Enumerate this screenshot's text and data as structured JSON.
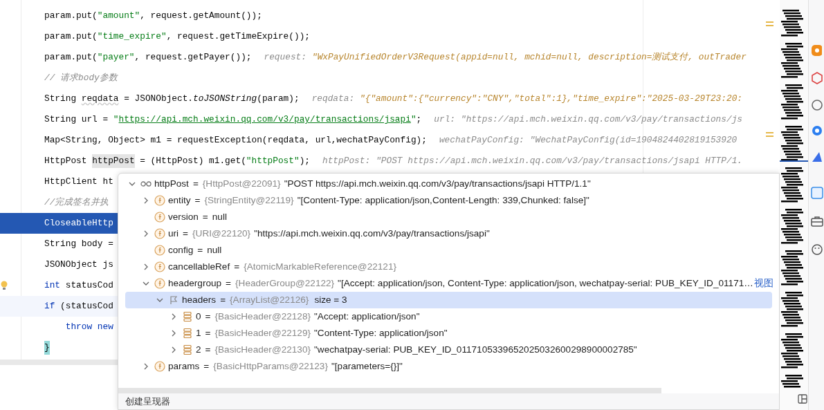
{
  "editor": {
    "lines": [
      {
        "kind": "normal",
        "bulb": false,
        "tokens": [
          {
            "kind": "plain",
            "text": "param.put("
          },
          {
            "kind": "string",
            "text": "\"amount\""
          },
          {
            "kind": "plain",
            "text": ", request.getAmount());"
          }
        ]
      },
      {
        "kind": "normal",
        "bulb": false,
        "tokens": [
          {
            "kind": "plain",
            "text": "param.put("
          },
          {
            "kind": "string",
            "text": "\"time_expire\""
          },
          {
            "kind": "plain",
            "text": ", request.getTimeExpire());"
          }
        ]
      },
      {
        "kind": "normal",
        "bulb": false,
        "tokens": [
          {
            "kind": "plain",
            "text": "param.put("
          },
          {
            "kind": "string",
            "text": "\"payer\""
          },
          {
            "kind": "plain",
            "text": ", request.getPayer());"
          }
        ],
        "hint": {
          "label": "request:",
          "value": "\"WxPayUnifiedOrderV3Request(appid=null, mchid=null, description=测试支付, outTrader",
          "changed": true
        }
      },
      {
        "kind": "normal",
        "bulb": false,
        "tokens": [
          {
            "kind": "comment",
            "text": "// 请求body参数"
          }
        ]
      },
      {
        "kind": "normal",
        "bulb": false,
        "tokens": [
          {
            "kind": "plain",
            "text": "String "
          },
          {
            "kind": "squiggle",
            "text": "reqdata"
          },
          {
            "kind": "plain",
            "text": " = JSONObject."
          },
          {
            "kind": "italic",
            "text": "toJSONString"
          },
          {
            "kind": "plain",
            "text": "(param);"
          }
        ],
        "hint": {
          "label": "reqdata:",
          "value": "\"{\"amount\":{\"currency\":\"CNY\",\"total\":1},\"time_expire\":\"2025-03-29T23:20:",
          "changed": true
        }
      },
      {
        "kind": "normal",
        "bulb": false,
        "tokens": [
          {
            "kind": "plain",
            "text": "String url = "
          },
          {
            "kind": "string",
            "text": "\""
          },
          {
            "kind": "link",
            "text": "https://api.mch.weixin.qq.com/v3/pay/transactions/jsapi"
          },
          {
            "kind": "string",
            "text": "\""
          },
          {
            "kind": "plain",
            "text": ";"
          }
        ],
        "hint": {
          "label": "url:",
          "value": "\"https://api.mch.weixin.qq.com/v3/pay/transactions/js",
          "changed": false
        }
      },
      {
        "kind": "normal",
        "bulb": false,
        "tokens": [
          {
            "kind": "plain",
            "text": "Map<String, Object> m1 = requestException(reqdata, url,wechatPayConfig);"
          }
        ],
        "hint": {
          "label": "wechatPayConfig:",
          "value": "\"WechatPayConfig(id=1904824402819153920",
          "changed": false
        }
      },
      {
        "kind": "normal",
        "bulb": false,
        "tokens": [
          {
            "kind": "plain",
            "text": "HttpPost "
          },
          {
            "kind": "mark",
            "text": "httpPost"
          },
          {
            "kind": "plain",
            "text": " = (HttpPost) m1.get("
          },
          {
            "kind": "string",
            "text": "\"httpPost\""
          },
          {
            "kind": "plain",
            "text": ");"
          }
        ],
        "hint": {
          "label": "httpPost:",
          "value": "\"POST https://api.mch.weixin.qq.com/v3/pay/transactions/jsapi HTTP/1.",
          "changed": false
        }
      },
      {
        "kind": "normal",
        "bulb": false,
        "tokens": [
          {
            "kind": "plain",
            "text": "HttpClient ht"
          }
        ]
      },
      {
        "kind": "normal",
        "bulb": false,
        "tokens": [
          {
            "kind": "comment",
            "text": "//完成签名并执"
          }
        ]
      },
      {
        "kind": "current",
        "bulb": false,
        "tokens": [
          {
            "kind": "plain",
            "text": "CloseableHttp"
          }
        ]
      },
      {
        "kind": "normal",
        "bulb": false,
        "tokens": [
          {
            "kind": "plain",
            "text": "String body ="
          }
        ]
      },
      {
        "kind": "normal",
        "bulb": false,
        "tokens": [
          {
            "kind": "plain",
            "text": "JSONObject js"
          }
        ]
      },
      {
        "kind": "normal",
        "bulb": true,
        "tokens": [
          {
            "kind": "keyword",
            "text": "int"
          },
          {
            "kind": "plain",
            "text": " statusCod"
          }
        ]
      },
      {
        "kind": "caret",
        "bulb": false,
        "tokens": [
          {
            "kind": "keyword",
            "text": "if"
          },
          {
            "kind": "plain",
            "text": " (statusCod"
          }
        ]
      },
      {
        "kind": "normal",
        "bulb": false,
        "tokens": [
          {
            "kind": "keyword",
            "text": "    throw new"
          }
        ]
      },
      {
        "kind": "normal",
        "bulb": false,
        "tokens": [
          {
            "kind": "match",
            "text": "}"
          }
        ]
      }
    ]
  },
  "debug_popup": {
    "tree": [
      {
        "kind": "watch",
        "name": "httpPost",
        "operator": "=",
        "ref": "{HttpPost@22091}",
        "value": "\"POST https://api.mch.weixin.qq.com/v3/pay/transactions/jsapi HTTP/1.1\"",
        "expanded": true,
        "selected": false,
        "children": [
          {
            "kind": "field",
            "name": "entity",
            "operator": "=",
            "ref": "{StringEntity@22119}",
            "value": "\"[Content-Type: application/json,Content-Length: 339,Chunked: false]\"",
            "expanded": false,
            "selected": false
          },
          {
            "kind": "field",
            "name": "version",
            "operator": "=",
            "value": "null",
            "selected": false
          },
          {
            "kind": "field",
            "name": "uri",
            "operator": "=",
            "ref": "{URI@22120}",
            "value": "\"https://api.mch.weixin.qq.com/v3/pay/transactions/jsapi\"",
            "expanded": false,
            "selected": false
          },
          {
            "kind": "field",
            "name": "config",
            "operator": "=",
            "value": "null",
            "selected": false
          },
          {
            "kind": "field",
            "name": "cancellableRef",
            "operator": "=",
            "ref": "{AtomicMarkableReference@22121}",
            "expanded": false,
            "selected": false
          },
          {
            "kind": "field",
            "name": "headergroup",
            "operator": "=",
            "ref": "{HeaderGroup@22122}",
            "value": "\"[Accept: application/json, Content-Type: application/json, wechatpay-serial: PUB_KEY_ID_01171…",
            "link": "视图",
            "expanded": true,
            "selected": false,
            "children": [
              {
                "kind": "list",
                "name": "headers",
                "operator": "=",
                "ref": "{ArrayList@22126}",
                "value": "size = 3",
                "expanded": true,
                "selected": true,
                "children": [
                  {
                    "kind": "element",
                    "name": "0",
                    "operator": "=",
                    "ref": "{BasicHeader@22128}",
                    "value": "\"Accept: application/json\"",
                    "expanded": false,
                    "selected": false
                  },
                  {
                    "kind": "element",
                    "name": "1",
                    "operator": "=",
                    "ref": "{BasicHeader@22129}",
                    "value": "\"Content-Type: application/json\"",
                    "expanded": false,
                    "selected": false
                  },
                  {
                    "kind": "element",
                    "name": "2",
                    "operator": "=",
                    "ref": "{BasicHeader@22130}",
                    "value": "\"wechatpay-serial: PUB_KEY_ID_0117105339652025032600298900002785\"",
                    "expanded": false,
                    "selected": false
                  }
                ]
              }
            ]
          },
          {
            "kind": "field",
            "name": "params",
            "operator": "=",
            "ref": "{BasicHttpParams@22123}",
            "value": "\"[parameters={}]\"",
            "expanded": false,
            "selected": false
          }
        ]
      }
    ],
    "footer": "创建呈现器"
  }
}
